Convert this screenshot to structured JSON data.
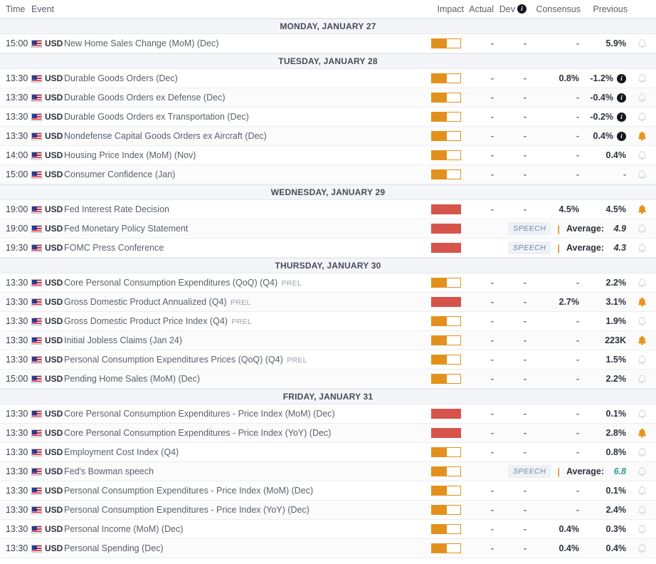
{
  "header": {
    "time": "Time",
    "event": "Event",
    "impact": "Impact",
    "actual": "Actual",
    "dev": "Dev",
    "dev_info_icon": "i",
    "consensus": "Consensus",
    "previous": "Previous"
  },
  "colors": {
    "impact_medium": "#e2911d",
    "impact_high": "#d6544b",
    "bell_active": "#e8941a",
    "bell_inactive": "#cfd3d8",
    "speech_text": "#6e89a8",
    "teal_value": "#2f9e8f",
    "day_band_bg": "#f4f5f8"
  },
  "labels": {
    "currency": "USD",
    "speech_badge": "SPEECH",
    "average_label": "Average:",
    "prel": "PREL",
    "dash": "-",
    "separator": "|"
  },
  "days": [
    {
      "title": "MONDAY, JANUARY 27",
      "rows": [
        {
          "time": "15:00",
          "currency": "USD",
          "flag": "us-flag-icon",
          "event": "New Home Sales Change (MoM) (Dec)",
          "prel": "",
          "impact": "medium",
          "type": "data",
          "actual": "-",
          "dev": "-",
          "consensus": "-",
          "previous": "5.9%",
          "info": false,
          "bell": "inactive"
        }
      ]
    },
    {
      "title": "TUESDAY, JANUARY 28",
      "rows": [
        {
          "time": "13:30",
          "currency": "USD",
          "flag": "us-flag-icon",
          "event": "Durable Goods Orders (Dec)",
          "prel": "",
          "impact": "medium",
          "type": "data",
          "actual": "-",
          "dev": "-",
          "consensus": "0.8%",
          "previous": "-1.2%",
          "info": true,
          "bell": "inactive"
        },
        {
          "time": "13:30",
          "currency": "USD",
          "flag": "us-flag-icon",
          "event": "Durable Goods Orders ex Defense (Dec)",
          "prel": "",
          "impact": "medium",
          "type": "data",
          "actual": "-",
          "dev": "-",
          "consensus": "-",
          "previous": "-0.4%",
          "info": true,
          "bell": "inactive"
        },
        {
          "time": "13:30",
          "currency": "USD",
          "flag": "us-flag-icon",
          "event": "Durable Goods Orders ex Transportation (Dec)",
          "prel": "",
          "impact": "medium",
          "type": "data",
          "actual": "-",
          "dev": "-",
          "consensus": "-",
          "previous": "-0.2%",
          "info": true,
          "bell": "inactive"
        },
        {
          "time": "13:30",
          "currency": "USD",
          "flag": "us-flag-icon",
          "event": "Nondefense Capital Goods Orders ex Aircraft (Dec)",
          "prel": "",
          "impact": "medium",
          "type": "data",
          "actual": "-",
          "dev": "-",
          "consensus": "-",
          "previous": "0.4%",
          "info": true,
          "bell": "active"
        },
        {
          "time": "14:00",
          "currency": "USD",
          "flag": "us-flag-icon",
          "event": "Housing Price Index (MoM) (Nov)",
          "prel": "",
          "impact": "medium",
          "type": "data",
          "actual": "-",
          "dev": "-",
          "consensus": "-",
          "previous": "0.4%",
          "info": false,
          "bell": "inactive"
        },
        {
          "time": "15:00",
          "currency": "USD",
          "flag": "us-flag-icon",
          "event": "Consumer Confidence (Jan)",
          "prel": "",
          "impact": "medium",
          "type": "data",
          "actual": "-",
          "dev": "-",
          "consensus": "-",
          "previous": "-",
          "info": false,
          "bell": "inactive"
        }
      ]
    },
    {
      "title": "WEDNESDAY, JANUARY 29",
      "rows": [
        {
          "time": "19:00",
          "currency": "USD",
          "flag": "us-flag-icon",
          "event": "Fed Interest Rate Decision",
          "prel": "",
          "impact": "high",
          "type": "data",
          "actual": "-",
          "dev": "-",
          "consensus": "4.5%",
          "previous": "4.5%",
          "info": false,
          "bell": "active"
        },
        {
          "time": "19:00",
          "currency": "USD",
          "flag": "us-flag-icon",
          "event": "Fed Monetary Policy Statement",
          "prel": "",
          "impact": "high",
          "type": "speech",
          "speech_badge": "SPEECH",
          "average_label": "Average:",
          "average_value": "4.9",
          "average_teal": false,
          "bell": "inactive"
        },
        {
          "time": "19:30",
          "currency": "USD",
          "flag": "us-flag-icon",
          "event": "FOMC Press Conference",
          "prel": "",
          "impact": "high",
          "type": "speech",
          "speech_badge": "SPEECH",
          "average_label": "Average:",
          "average_value": "4.3",
          "average_teal": false,
          "bell": "inactive"
        }
      ]
    },
    {
      "title": "THURSDAY, JANUARY 30",
      "rows": [
        {
          "time": "13:30",
          "currency": "USD",
          "flag": "us-flag-icon",
          "event": "Core Personal Consumption Expenditures (QoQ) (Q4)",
          "prel": "PREL",
          "impact": "medium",
          "type": "data",
          "actual": "-",
          "dev": "-",
          "consensus": "-",
          "previous": "2.2%",
          "info": false,
          "bell": "inactive"
        },
        {
          "time": "13:30",
          "currency": "USD",
          "flag": "us-flag-icon",
          "event": "Gross Domestic Product Annualized (Q4)",
          "prel": "PREL",
          "impact": "high",
          "type": "data",
          "actual": "-",
          "dev": "-",
          "consensus": "2.7%",
          "previous": "3.1%",
          "info": false,
          "bell": "active"
        },
        {
          "time": "13:30",
          "currency": "USD",
          "flag": "us-flag-icon",
          "event": "Gross Domestic Product Price Index (Q4)",
          "prel": "PREL",
          "impact": "medium",
          "type": "data",
          "actual": "-",
          "dev": "-",
          "consensus": "-",
          "previous": "1.9%",
          "info": false,
          "bell": "inactive"
        },
        {
          "time": "13:30",
          "currency": "USD",
          "flag": "us-flag-icon",
          "event": "Initial Jobless Claims (Jan 24)",
          "prel": "",
          "impact": "medium",
          "type": "data",
          "actual": "-",
          "dev": "-",
          "consensus": "-",
          "previous": "223K",
          "info": false,
          "bell": "active"
        },
        {
          "time": "13:30",
          "currency": "USD",
          "flag": "us-flag-icon",
          "event": "Personal Consumption Expenditures Prices (QoQ) (Q4)",
          "prel": "PREL",
          "impact": "medium",
          "type": "data",
          "actual": "-",
          "dev": "-",
          "consensus": "-",
          "previous": "1.5%",
          "info": false,
          "bell": "inactive"
        },
        {
          "time": "15:00",
          "currency": "USD",
          "flag": "us-flag-icon",
          "event": "Pending Home Sales (MoM) (Dec)",
          "prel": "",
          "impact": "medium",
          "type": "data",
          "actual": "-",
          "dev": "-",
          "consensus": "-",
          "previous": "2.2%",
          "info": false,
          "bell": "inactive"
        }
      ]
    },
    {
      "title": "FRIDAY, JANUARY 31",
      "rows": [
        {
          "time": "13:30",
          "currency": "USD",
          "flag": "us-flag-icon",
          "event": "Core Personal Consumption Expenditures - Price Index (MoM) (Dec)",
          "prel": "",
          "impact": "high",
          "type": "data",
          "actual": "-",
          "dev": "-",
          "consensus": "-",
          "previous": "0.1%",
          "info": false,
          "bell": "inactive"
        },
        {
          "time": "13:30",
          "currency": "USD",
          "flag": "us-flag-icon",
          "event": "Core Personal Consumption Expenditures - Price Index (YoY) (Dec)",
          "prel": "",
          "impact": "high",
          "type": "data",
          "actual": "-",
          "dev": "-",
          "consensus": "-",
          "previous": "2.8%",
          "info": false,
          "bell": "active"
        },
        {
          "time": "13:30",
          "currency": "USD",
          "flag": "us-flag-icon",
          "event": "Employment Cost Index (Q4)",
          "prel": "",
          "impact": "medium",
          "type": "data",
          "actual": "-",
          "dev": "-",
          "consensus": "-",
          "previous": "0.8%",
          "info": false,
          "bell": "inactive"
        },
        {
          "time": "13:30",
          "currency": "USD",
          "flag": "us-flag-icon",
          "event": "Fed's Bowman speech",
          "prel": "",
          "impact": "medium",
          "type": "speech",
          "speech_badge": "SPEECH",
          "average_label": "Average:",
          "average_value": "6.8",
          "average_teal": true,
          "bell": "inactive"
        },
        {
          "time": "13:30",
          "currency": "USD",
          "flag": "us-flag-icon",
          "event": "Personal Consumption Expenditures - Price Index (MoM) (Dec)",
          "prel": "",
          "impact": "medium",
          "type": "data",
          "actual": "-",
          "dev": "-",
          "consensus": "-",
          "previous": "0.1%",
          "info": false,
          "bell": "inactive"
        },
        {
          "time": "13:30",
          "currency": "USD",
          "flag": "us-flag-icon",
          "event": "Personal Consumption Expenditures - Price Index (YoY) (Dec)",
          "prel": "",
          "impact": "medium",
          "type": "data",
          "actual": "-",
          "dev": "-",
          "consensus": "-",
          "previous": "2.4%",
          "info": false,
          "bell": "inactive"
        },
        {
          "time": "13:30",
          "currency": "USD",
          "flag": "us-flag-icon",
          "event": "Personal Income (MoM) (Dec)",
          "prel": "",
          "impact": "medium",
          "type": "data",
          "actual": "-",
          "dev": "-",
          "consensus": "0.4%",
          "previous": "0.3%",
          "info": false,
          "bell": "inactive"
        },
        {
          "time": "13:30",
          "currency": "USD",
          "flag": "us-flag-icon",
          "event": "Personal Spending (Dec)",
          "prel": "",
          "impact": "medium",
          "type": "data",
          "actual": "-",
          "dev": "-",
          "consensus": "0.4%",
          "previous": "0.4%",
          "info": false,
          "bell": "inactive"
        }
      ]
    }
  ]
}
